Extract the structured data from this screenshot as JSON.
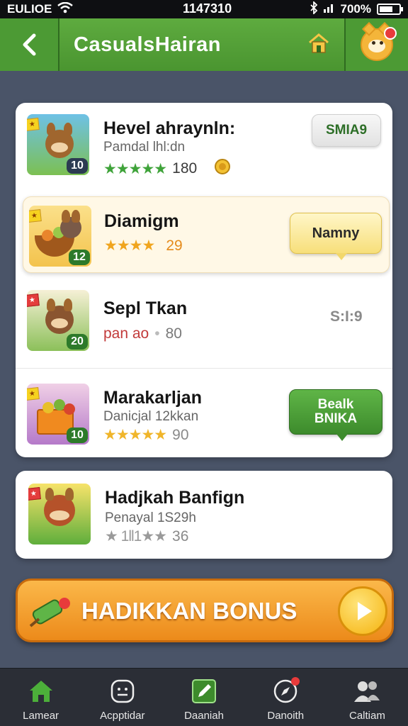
{
  "status_bar": {
    "carrier": "EULIOE",
    "time": "1147310",
    "battery": "700%",
    "battery_level": 0.7,
    "icons": [
      "wifi-icon",
      "bluetooth-icon",
      "signal-icon",
      "battery-icon"
    ]
  },
  "header": {
    "title": "CasualsHairan",
    "back_icon": "chevron-left-icon",
    "home_icon": "house-icon",
    "avatar": "cat-avatar"
  },
  "colors": {
    "header_green": "#4c9a34",
    "bonus_orange": "#ec8a1a",
    "background": "#4a5468",
    "nav_bg": "#2b2e36"
  },
  "games": [
    {
      "title": "Hevel ahraynln:",
      "subtitle": "Pamdal lhl:dn",
      "stars": "★★★★★",
      "rating": "180",
      "badge": "10",
      "button": "SMIA9",
      "extra_icon": "coin-icon"
    },
    {
      "title": "Diamigm",
      "stars": "★★★★",
      "rating": "29",
      "badge": "12",
      "button": "Namny"
    },
    {
      "title": "Sepl Tkan",
      "subtitle": "pan ao",
      "rating": "80",
      "badge": "20",
      "price": "S:I:9"
    },
    {
      "title": "Marakarljan",
      "subtitle": "Danicjal 12kkan",
      "stars": "★★★★★",
      "rating": "90",
      "badge": "10",
      "button": "Bealk BNIKA"
    },
    {
      "title": "Hadjkah Banfign",
      "subtitle": "Penayal 1S29h",
      "stars": "★ 1ll1★★",
      "rating": "36"
    }
  ],
  "bonus": {
    "label": "HADIKKAN BONUS",
    "icon": "play-icon"
  },
  "bottom_nav": [
    {
      "label": "Lamear",
      "icon": "home-icon"
    },
    {
      "label": "Acpptidar",
      "icon": "chat-icon"
    },
    {
      "label": "Daaniah",
      "icon": "edit-icon"
    },
    {
      "label": "Danoith",
      "icon": "compass-icon"
    },
    {
      "label": "Caltiam",
      "icon": "people-icon"
    }
  ]
}
